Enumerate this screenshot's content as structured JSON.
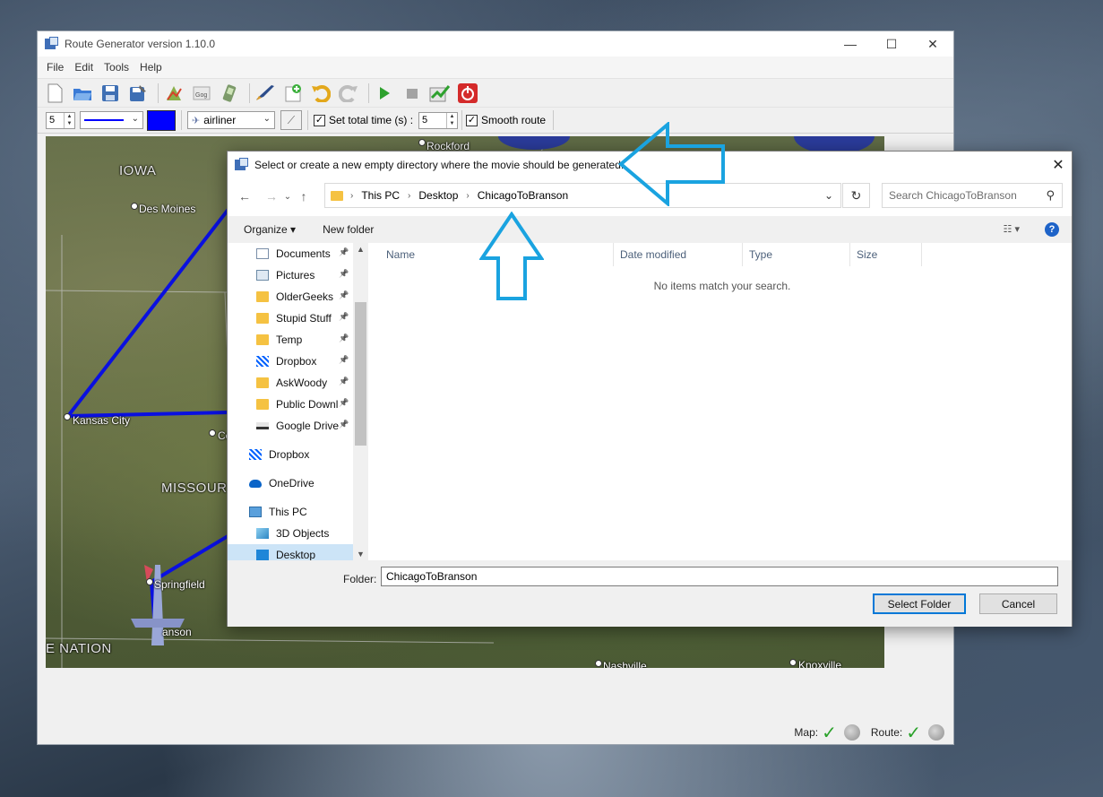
{
  "app": {
    "title": "Route Generator version 1.10.0",
    "menu": [
      "File",
      "Edit",
      "Tools",
      "Help"
    ],
    "toolbar2": {
      "width_value": "5",
      "line_style": "——————",
      "color": "#0000ff",
      "vehicle": "airliner",
      "set_total_time_label": "Set total time (s) :",
      "set_total_time_checked": true,
      "total_time_value": "5",
      "smooth_route_label": "Smooth route",
      "smooth_route_checked": true
    },
    "map": {
      "labels": {
        "iowa": "IOWA",
        "des_moines": "Des Moines",
        "kansas_city": "Kansas City",
        "missouri": "MISSOUR",
        "springfield": "Springfield",
        "branson": "anson",
        "nation": "E NATION",
        "rockford": "Rockford",
        "nashville": "Nashville",
        "knoxville": "Knoxville",
        "columbia_partial": "Co"
      },
      "route_color": "#0a10e0"
    },
    "status": {
      "map_label": "Map:",
      "route_label": "Route:"
    }
  },
  "dialog": {
    "title": "Select or create a new empty directory where the movie should be generated.",
    "breadcrumb": [
      "This PC",
      "Desktop",
      "ChicagoToBranson"
    ],
    "search_placeholder": "Search ChicagoToBranson",
    "organize": "Organize ▾",
    "new_folder": "New folder",
    "help": "?",
    "nav_items": [
      {
        "label": "Documents",
        "icon": "docs",
        "pinned": true,
        "indent": 1
      },
      {
        "label": "Pictures",
        "icon": "pics",
        "pinned": true,
        "indent": 1
      },
      {
        "label": "OlderGeeks",
        "icon": "folder",
        "pinned": true,
        "indent": 1
      },
      {
        "label": "Stupid Stuff",
        "icon": "folder",
        "pinned": true,
        "indent": 1
      },
      {
        "label": "Temp",
        "icon": "folder",
        "pinned": true,
        "indent": 1
      },
      {
        "label": "Dropbox",
        "icon": "dropbox",
        "pinned": true,
        "indent": 1
      },
      {
        "label": "AskWoody",
        "icon": "folder",
        "pinned": true,
        "indent": 1
      },
      {
        "label": "Public Downl",
        "icon": "folder",
        "pinned": true,
        "indent": 1
      },
      {
        "label": "Google Drive",
        "icon": "drive",
        "pinned": true,
        "indent": 1
      },
      {
        "label": "Dropbox",
        "icon": "dropbox",
        "pinned": false,
        "indent": 0
      },
      {
        "label": "OneDrive",
        "icon": "onedrive",
        "pinned": false,
        "indent": 0
      },
      {
        "label": "This PC",
        "icon": "pc",
        "pinned": false,
        "indent": 0
      },
      {
        "label": "3D Objects",
        "icon": "obj3d",
        "pinned": false,
        "indent": 1
      },
      {
        "label": "Desktop",
        "icon": "desktop",
        "pinned": false,
        "indent": 1,
        "selected": true
      }
    ],
    "columns": [
      "Name",
      "Date modified",
      "Type",
      "Size"
    ],
    "empty_message": "No items match your search.",
    "folder_label": "Folder:",
    "folder_value": "ChicagoToBranson",
    "select_button": "Select Folder",
    "cancel_button": "Cancel"
  },
  "colors": {
    "callout_arrow": "#1aa3e0",
    "accent": "#0078d7"
  }
}
